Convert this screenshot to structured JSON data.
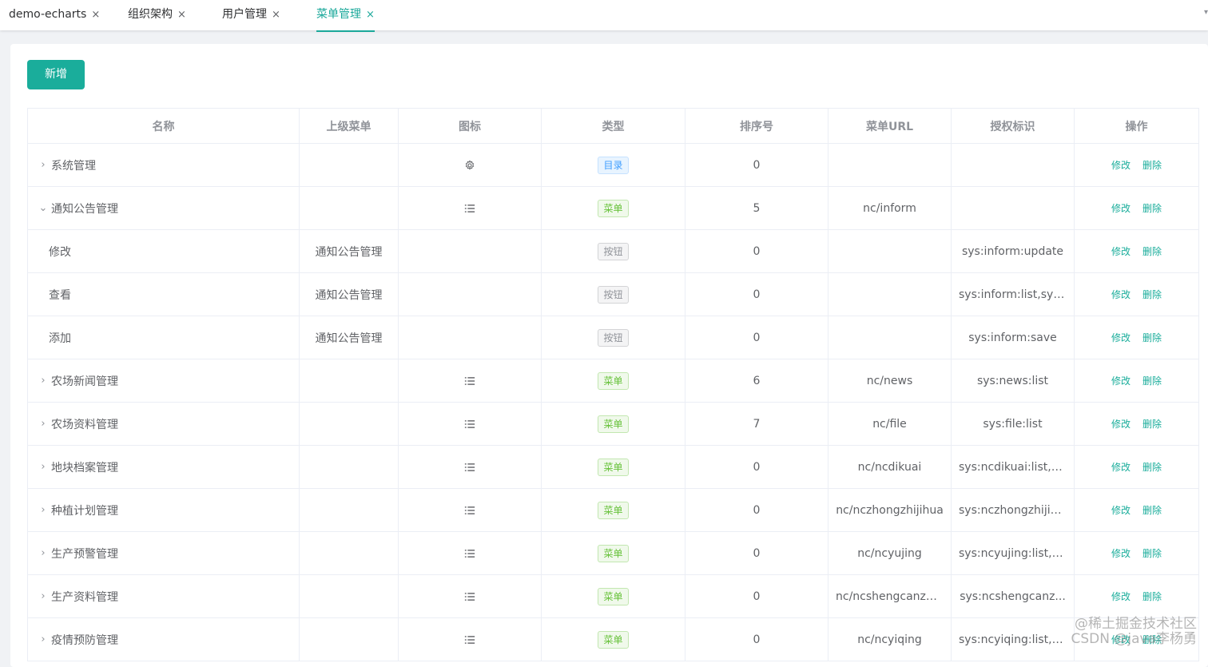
{
  "tabs": [
    {
      "label": "demo-echarts",
      "active": false
    },
    {
      "label": "组织架构",
      "active": false
    },
    {
      "label": "用户管理",
      "active": false
    },
    {
      "label": "菜单管理",
      "active": true
    }
  ],
  "close_glyph": "×",
  "toolbar": {
    "add_label": "新增"
  },
  "table": {
    "columns": [
      "名称",
      "上级菜单",
      "图标",
      "类型",
      "排序号",
      "菜单URL",
      "授权标识",
      "操作"
    ],
    "rows": [
      {
        "name": "系统管理",
        "expand": "collapsed",
        "parent": "",
        "icon": "gear-icon",
        "type": "目录",
        "type_kind": "dir",
        "order": "0",
        "url": "",
        "perm": "",
        "edit": "修改",
        "del": "删除"
      },
      {
        "name": "通知公告管理",
        "expand": "expanded",
        "parent": "",
        "icon": "list-icon",
        "type": "菜单",
        "type_kind": "menu",
        "order": "5",
        "url": "nc/inform",
        "perm": "",
        "edit": "修改",
        "del": "删除"
      },
      {
        "name": "修改",
        "expand": "none",
        "parent": "通知公告管理",
        "icon": "",
        "type": "按钮",
        "type_kind": "btn",
        "order": "0",
        "url": "",
        "perm": "sys:inform:update",
        "edit": "修改",
        "del": "删除"
      },
      {
        "name": "查看",
        "expand": "none",
        "parent": "通知公告管理",
        "icon": "",
        "type": "按钮",
        "type_kind": "btn",
        "order": "0",
        "url": "",
        "perm": "sys:inform:list,sys:...",
        "edit": "修改",
        "del": "删除"
      },
      {
        "name": "添加",
        "expand": "none",
        "parent": "通知公告管理",
        "icon": "",
        "type": "按钮",
        "type_kind": "btn",
        "order": "0",
        "url": "",
        "perm": "sys:inform:save",
        "edit": "修改",
        "del": "删除"
      },
      {
        "name": "农场新闻管理",
        "expand": "collapsed",
        "parent": "",
        "icon": "list-icon",
        "type": "菜单",
        "type_kind": "menu",
        "order": "6",
        "url": "nc/news",
        "perm": "sys:news:list",
        "edit": "修改",
        "del": "删除"
      },
      {
        "name": "农场资料管理",
        "expand": "collapsed",
        "parent": "",
        "icon": "list-icon",
        "type": "菜单",
        "type_kind": "menu",
        "order": "7",
        "url": "nc/file",
        "perm": "sys:file:list",
        "edit": "修改",
        "del": "删除"
      },
      {
        "name": "地块档案管理",
        "expand": "collapsed",
        "parent": "",
        "icon": "list-icon",
        "type": "菜单",
        "type_kind": "menu",
        "order": "0",
        "url": "nc/ncdikuai",
        "perm": "sys:ncdikuai:list,s...",
        "edit": "修改",
        "del": "删除"
      },
      {
        "name": "种植计划管理",
        "expand": "collapsed",
        "parent": "",
        "icon": "list-icon",
        "type": "菜单",
        "type_kind": "menu",
        "order": "0",
        "url": "nc/nczhongzhijihua",
        "perm": "sys:nczhongzhijih...",
        "edit": "修改",
        "del": "删除"
      },
      {
        "name": "生产预警管理",
        "expand": "collapsed",
        "parent": "",
        "icon": "list-icon",
        "type": "菜单",
        "type_kind": "menu",
        "order": "0",
        "url": "nc/ncyujing",
        "perm": "sys:ncyujing:list,s...",
        "edit": "修改",
        "del": "删除"
      },
      {
        "name": "生产资料管理",
        "expand": "collapsed",
        "parent": "",
        "icon": "list-icon",
        "type": "菜单",
        "type_kind": "menu",
        "order": "0",
        "url": "nc/ncshengcanzhi...",
        "perm": "sys:ncshengcanz...",
        "edit": "修改",
        "del": "删除"
      },
      {
        "name": "疫情预防管理",
        "expand": "collapsed",
        "parent": "",
        "icon": "list-icon",
        "type": "菜单",
        "type_kind": "menu",
        "order": "0",
        "url": "nc/ncyiqing",
        "perm": "sys:ncyiqing:list,s...",
        "edit": "修改",
        "del": "删除"
      }
    ]
  },
  "watermark": {
    "line1": "@稀土掘金技术社区",
    "line2": "CSDN @java李杨勇"
  },
  "colors": {
    "accent": "#1aad9b",
    "dir_tag": "#409eff",
    "menu_tag": "#67c23a",
    "btn_tag": "#909399"
  }
}
